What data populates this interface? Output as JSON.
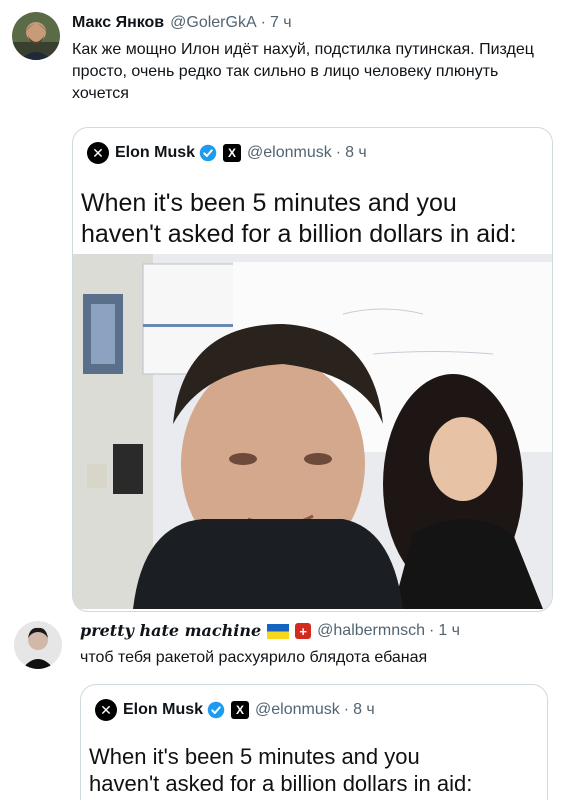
{
  "tweet1": {
    "author_name": "Макс Янков",
    "handle": "@GolerGkA",
    "separator": "·",
    "time": "7 ч",
    "text": "Как же мощно Илон идёт нахуй, подстилка путинская. Пиздец просто, очень редко так сильно в лицо человеку плюнуть хочется"
  },
  "quote1": {
    "author_name": "Elon Musk",
    "badge": "X",
    "handle": "@elonmusk",
    "separator": "·",
    "time": "8 ч",
    "meme_caption_line1": "When it's been 5 minutes and you",
    "meme_caption_line2": "haven't asked for a billion dollars in aid:"
  },
  "tweet2": {
    "author_name": "pretty hate machine",
    "handle": "@halbermnsch",
    "separator": "·",
    "time": "1 ч",
    "text": "чтоб тебя ракетой расхуярило блядота ебаная",
    "swiss_cross": "+"
  },
  "quote2": {
    "author_name": "Elon Musk",
    "badge": "X",
    "handle": "@elonmusk",
    "separator": "·",
    "time": "8 ч",
    "meme_caption_line1": "When it's been 5 minutes and you",
    "meme_caption_line2": "haven't asked for a billion dollars in aid:"
  },
  "colors": {
    "verified_blue": "#1d9bf0",
    "text_secondary": "#536471",
    "border": "#cfd9de"
  }
}
